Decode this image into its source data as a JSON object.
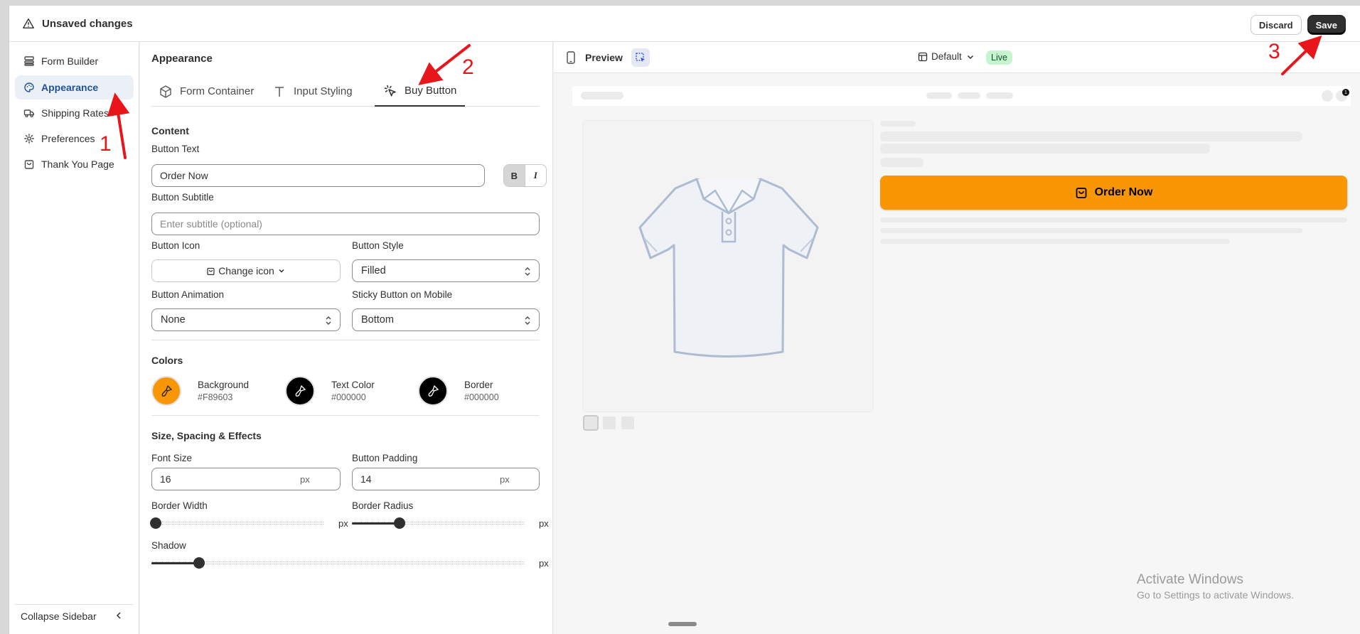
{
  "topbar": {
    "title": "Unsaved changes",
    "discard": "Discard",
    "save": "Save"
  },
  "sidebar": {
    "items": [
      {
        "label": "Form Builder",
        "icon": "layout-icon"
      },
      {
        "label": "Appearance",
        "icon": "palette-icon",
        "active": true
      },
      {
        "label": "Shipping Rates",
        "icon": "truck-icon"
      },
      {
        "label": "Preferences",
        "icon": "gear-icon"
      },
      {
        "label": "Thank You Page",
        "icon": "bag-icon"
      }
    ],
    "collapse": "Collapse Sidebar"
  },
  "panel": {
    "title": "Appearance",
    "tabs": [
      {
        "label": "Form Container",
        "icon": "cube-icon"
      },
      {
        "label": "Input Styling",
        "icon": "text-icon"
      },
      {
        "label": "Buy Button",
        "icon": "cursor-click-icon",
        "active": true
      }
    ],
    "content": {
      "title": "Content",
      "button_text_label": "Button Text",
      "button_text_value": "Order Now",
      "bold": "B",
      "italic": "I",
      "subtitle_label": "Button Subtitle",
      "subtitle_placeholder": "Enter subtitle (optional)",
      "icon_label": "Button Icon",
      "change_icon": "Change icon",
      "style_label": "Button Style",
      "style_value": "Filled",
      "animation_label": "Button Animation",
      "animation_value": "None",
      "sticky_label": "Sticky Button on Mobile",
      "sticky_value": "Bottom"
    },
    "colors": {
      "title": "Colors",
      "items": [
        {
          "name": "Background",
          "hex": "#F89603"
        },
        {
          "name": "Text Color",
          "hex": "#000000"
        },
        {
          "name": "Border",
          "hex": "#000000"
        }
      ]
    },
    "size": {
      "title": "Size, Spacing & Effects",
      "font_size_label": "Font Size",
      "font_size_value": "16",
      "padding_label": "Button Padding",
      "padding_value": "14",
      "unit": "px",
      "border_width_label": "Border Width",
      "border_width_fraction": 0.0,
      "border_radius_label": "Border Radius",
      "border_radius_fraction": 0.25,
      "shadow_label": "Shadow",
      "shadow_fraction": 0.25
    }
  },
  "preview": {
    "title": "Preview",
    "theme": "Default",
    "status": "Live",
    "order_button": "Order Now",
    "cart_count": "1"
  },
  "annotations": [
    "1",
    "2",
    "3"
  ],
  "watermark": {
    "line1": "Activate Windows",
    "line2": "Go to Settings to activate Windows."
  },
  "colors": {
    "accent": "#F89603",
    "active_nav": "#1F5199",
    "live_bg": "#C6F4CF"
  }
}
